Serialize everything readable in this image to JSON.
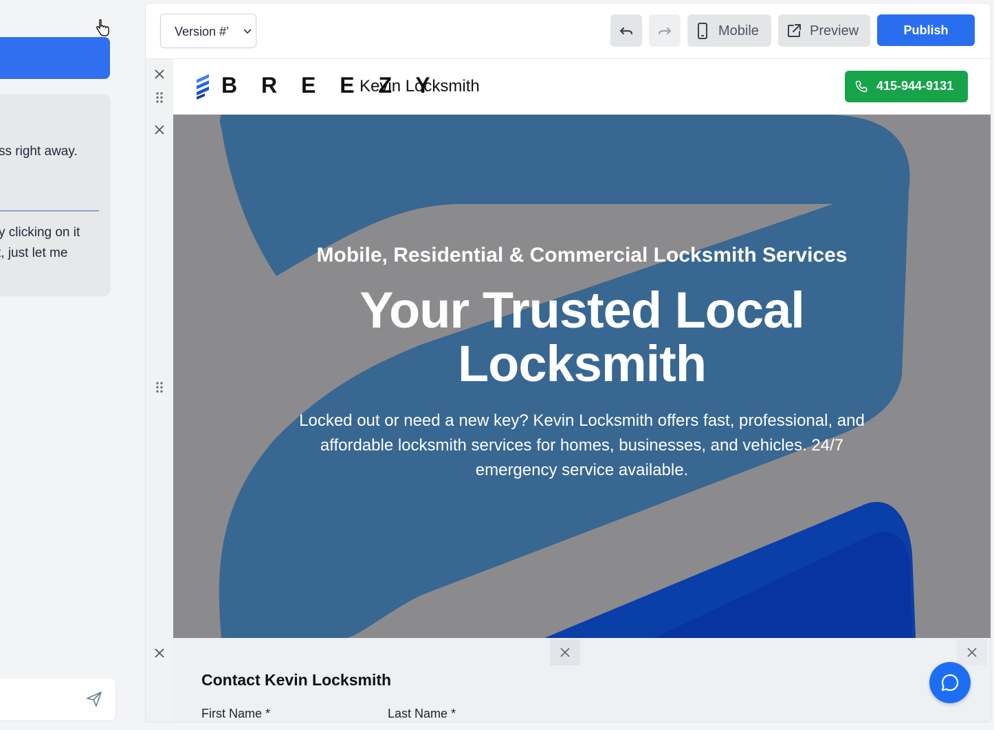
{
  "chat_panel": {
    "message_line1": "ss right away.",
    "message_line2": "y clicking on it",
    "message_line3": "t, just let me",
    "input_placeholder": ""
  },
  "toolbar": {
    "version_label": "Version #’",
    "mobile_label": "Mobile",
    "preview_label": "Preview",
    "publish_label": "Publish"
  },
  "site": {
    "logo_text": "B R E E Z Y",
    "business_name": "Kevin Locksmith",
    "phone": "415-944-9131",
    "hero": {
      "subtitle": "Mobile, Residential & Commercial Locksmith Services",
      "title_line1": "Your Trusted Local",
      "title_line2": "Locksmith",
      "description": "Locked out or need a new key? Kevin Locksmith offers fast, professional, and affordable locksmith services for homes, businesses, and vehicles. 24/7 emergency service available."
    },
    "contact": {
      "title": "Contact Kevin Locksmith",
      "first_name_label": "First Name *",
      "last_name_label": "Last Name *"
    }
  },
  "colors": {
    "primary_blue": "#2a6ef0",
    "phone_green": "#16a34a",
    "hero_overlay": "#8a8a8c"
  }
}
